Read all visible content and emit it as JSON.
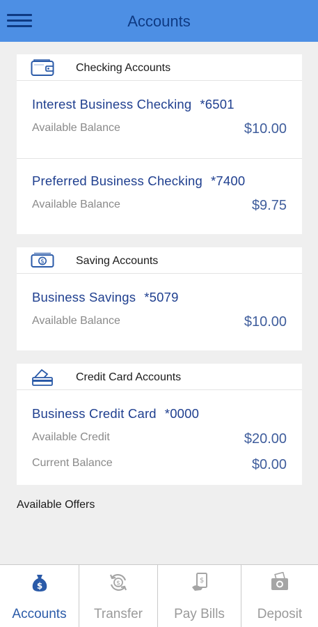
{
  "header": {
    "title": "Accounts",
    "menu_icon": "hamburger-menu-icon"
  },
  "checking": {
    "section_title": "Checking Accounts",
    "icon": "wallet-icon",
    "accounts": [
      {
        "name": "Interest Business Checking",
        "number": "*6501",
        "label": "Available Balance",
        "value": "$10.00"
      },
      {
        "name": "Preferred Business Checking",
        "number": "*7400",
        "label": "Available Balance",
        "value": "$9.75"
      }
    ]
  },
  "savings": {
    "section_title": "Saving Accounts",
    "icon": "cash-bill-icon",
    "accounts": [
      {
        "name": "Business Savings",
        "number": "*5079",
        "label": "Available Balance",
        "value": "$10.00"
      }
    ]
  },
  "credit": {
    "section_title": "Credit Card Accounts",
    "icon": "credit-card-icon",
    "account": {
      "name": "Business Credit Card",
      "number": "*0000",
      "credit_label": "Available Credit",
      "credit_value": "$20.00",
      "balance_label": "Current Balance",
      "balance_value": "$0.00"
    }
  },
  "offers": {
    "title": "Available Offers"
  },
  "tabs": [
    {
      "label": "Accounts",
      "icon": "money-bag-icon",
      "active": true
    },
    {
      "label": "Transfer",
      "icon": "transfer-cycle-icon",
      "active": false
    },
    {
      "label": "Pay Bills",
      "icon": "pay-bills-icon",
      "active": false
    },
    {
      "label": "Deposit",
      "icon": "camera-deposit-icon",
      "active": false
    }
  ],
  "colors": {
    "header": "#4d8fe4",
    "header_text": "#0e3a83",
    "account_name": "#1f3f8f",
    "active_tab": "#2a5aa8",
    "inactive_tab": "#9a9a9a"
  }
}
